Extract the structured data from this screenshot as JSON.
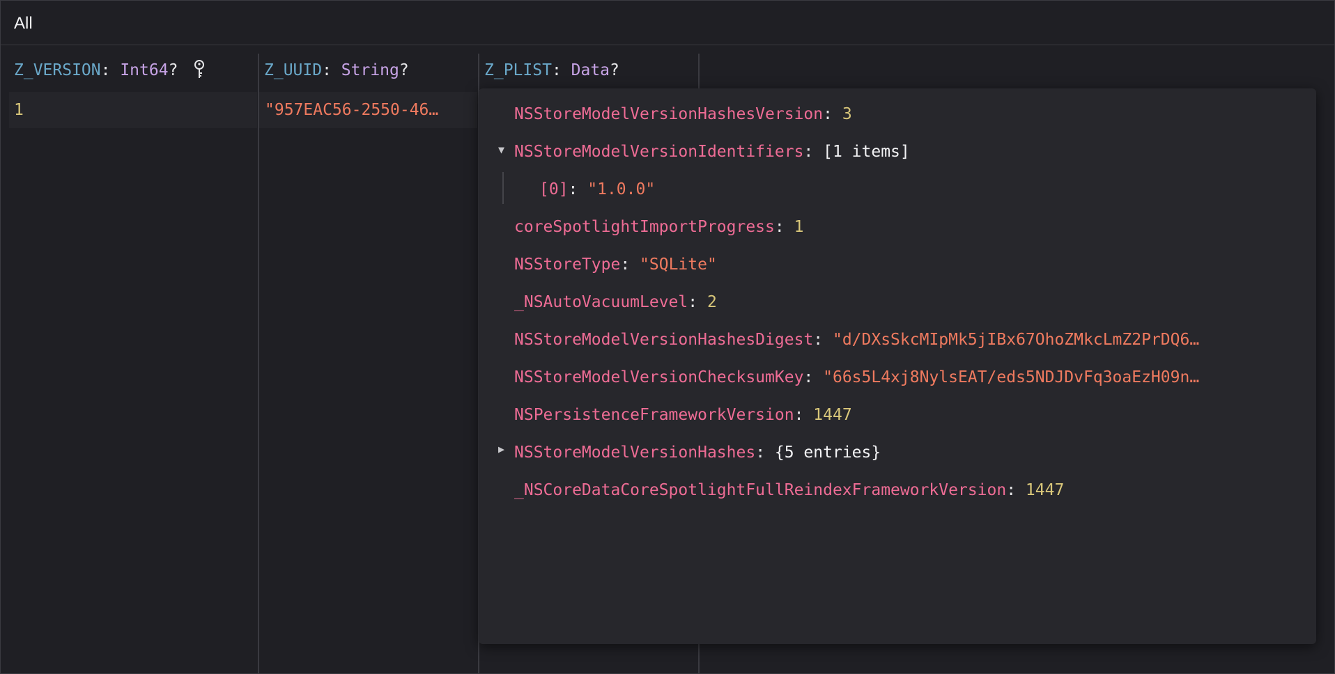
{
  "filter": {
    "label": "All"
  },
  "columns": [
    {
      "name": "Z_VERSION",
      "separator": ": ",
      "type": "Int64",
      "optional": "?",
      "is_primary_key": true
    },
    {
      "name": "Z_UUID",
      "separator": ": ",
      "type": "String",
      "optional": "?"
    },
    {
      "name": "Z_PLIST",
      "separator": ": ",
      "type": "Data",
      "optional": "?"
    }
  ],
  "row": {
    "z_version": "1",
    "z_uuid": "\"957EAC56-2550-46…"
  },
  "plist": {
    "items": [
      {
        "key": "NSStoreModelVersionHashesVersion",
        "sep": ": ",
        "value": "3",
        "value_kind": "number"
      },
      {
        "key": "NSStoreModelVersionIdentifiers",
        "sep": ": ",
        "value": "[1 items]",
        "value_kind": "collection",
        "expanded": true
      },
      {
        "key": "[0]",
        "sep": ": ",
        "value": "\"1.0.0\"",
        "value_kind": "string",
        "child": true
      },
      {
        "key": "coreSpotlightImportProgress",
        "sep": ": ",
        "value": "1",
        "value_kind": "number"
      },
      {
        "key": "NSStoreType",
        "sep": ": ",
        "value": "\"SQLite\"",
        "value_kind": "string"
      },
      {
        "key": "_NSAutoVacuumLevel",
        "sep": ": ",
        "value": "2",
        "value_kind": "number"
      },
      {
        "key": "NSStoreModelVersionHashesDigest",
        "sep": ": ",
        "value": "\"d/DXsSkcMIpMk5jIBx67OhoZMkcLmZ2PrDQ6…",
        "value_kind": "string"
      },
      {
        "key": "NSStoreModelVersionChecksumKey",
        "sep": ": ",
        "value": "\"66s5L4xj8NylsEAT/eds5NDJDvFq3oaEzH09n…",
        "value_kind": "string"
      },
      {
        "key": "NSPersistenceFrameworkVersion",
        "sep": ": ",
        "value": "1447",
        "value_kind": "number"
      },
      {
        "key": "NSStoreModelVersionHashes",
        "sep": ": ",
        "value": "{5 entries}",
        "value_kind": "collection",
        "expanded": false
      },
      {
        "key": "_NSCoreDataCoreSpotlightFullReindexFrameworkVersion",
        "sep": ": ",
        "value": "1447",
        "value_kind": "number"
      }
    ]
  },
  "colors": {
    "background": "#1f1f24",
    "column_name": "#6aa8c9",
    "type_name": "#c7a3e6",
    "key": "#ee6c95",
    "number": "#d9c77a",
    "string": "#ef7a5f"
  },
  "icons": {
    "primary_key": "key-icon",
    "expanded": "disclosure-triangle-down-icon",
    "collapsed": "disclosure-triangle-right-icon"
  }
}
